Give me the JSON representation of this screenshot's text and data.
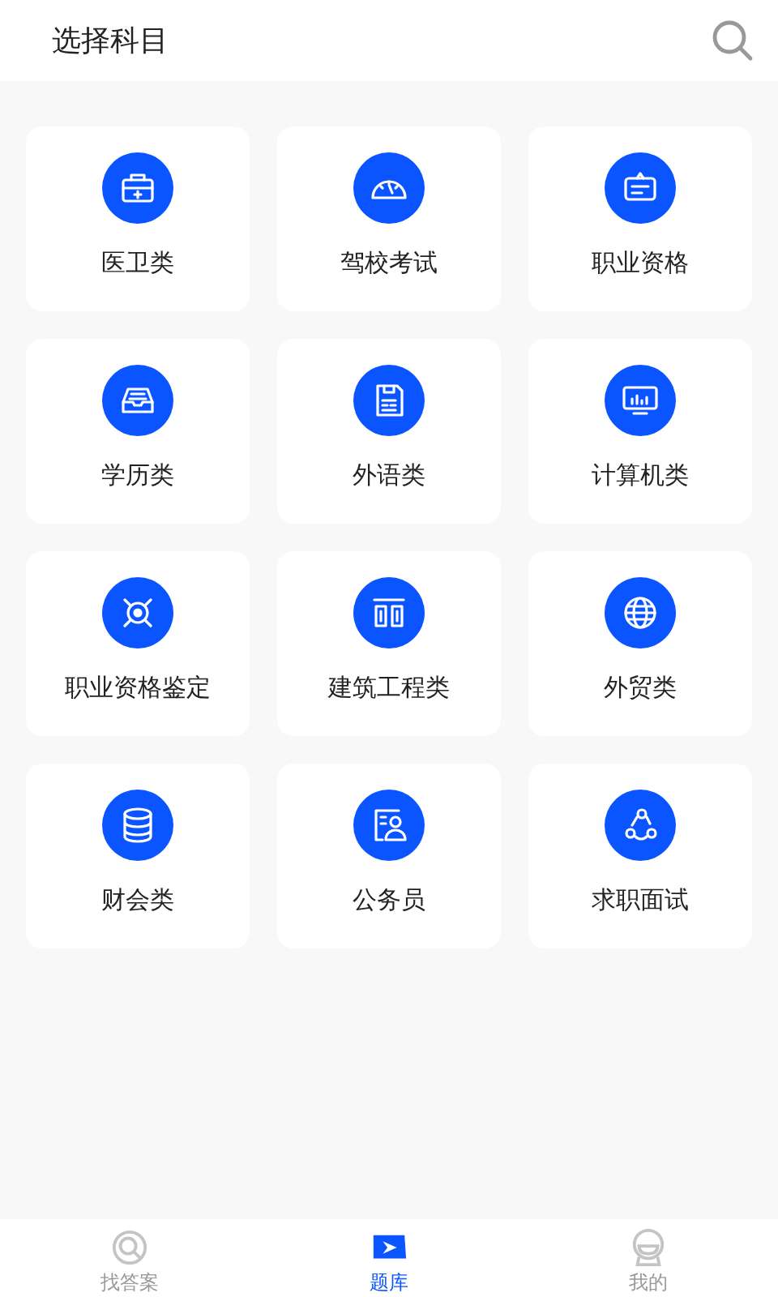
{
  "header": {
    "title": "选择科目"
  },
  "subjects": [
    {
      "label": "医卫类"
    },
    {
      "label": "驾校考试"
    },
    {
      "label": "职业资格"
    },
    {
      "label": "学历类"
    },
    {
      "label": "外语类"
    },
    {
      "label": "计算机类"
    },
    {
      "label": "职业资格鉴定"
    },
    {
      "label": "建筑工程类"
    },
    {
      "label": "外贸类"
    },
    {
      "label": "财会类"
    },
    {
      "label": "公务员"
    },
    {
      "label": "求职面试"
    }
  ],
  "tab_bar": [
    {
      "label": "找答案",
      "selected": false
    },
    {
      "label": "题库",
      "selected": true
    },
    {
      "label": "我的",
      "selected": false
    }
  ]
}
